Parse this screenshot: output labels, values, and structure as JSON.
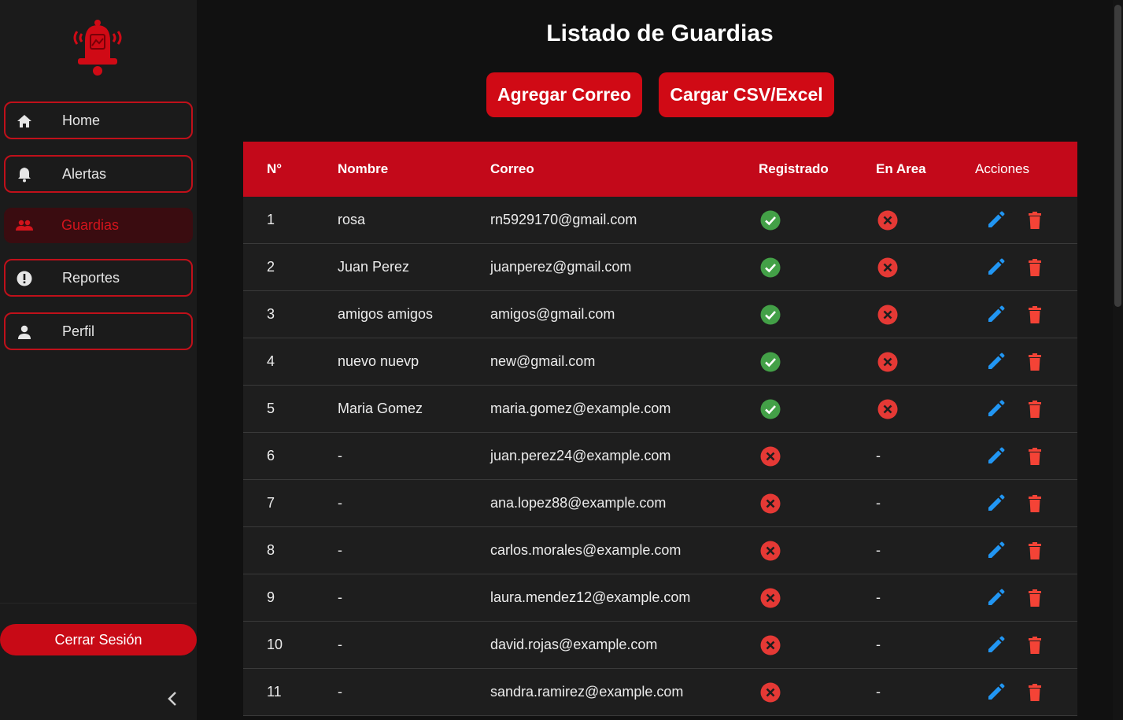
{
  "sidebar": {
    "items": [
      {
        "label": "Home",
        "icon": "home-icon"
      },
      {
        "label": "Alertas",
        "icon": "bell-icon"
      },
      {
        "label": "Guardias",
        "icon": "users-icon",
        "active": true
      },
      {
        "label": "Reportes",
        "icon": "alert-circle-icon"
      },
      {
        "label": "Perfil",
        "icon": "person-icon"
      }
    ],
    "logout_label": "Cerrar Sesión",
    "collapse_icon": "chevron-left-icon",
    "logo_icon": "alarm-bell-logo"
  },
  "page": {
    "title": "Listado de Guardias",
    "add_button": "Agregar Correo",
    "csv_button": "Cargar CSV/Excel"
  },
  "table": {
    "headers": {
      "num": "N°",
      "name": "Nombre",
      "email": "Correo",
      "registered": "Registrado",
      "in_area": "En Area",
      "actions": "Acciones"
    },
    "rows": [
      {
        "num": "1",
        "name": "rosa",
        "email": "rn5929170@gmail.com",
        "registered": true,
        "in_area": "no"
      },
      {
        "num": "2",
        "name": "Juan Perez",
        "email": "juanperez@gmail.com",
        "registered": true,
        "in_area": "no"
      },
      {
        "num": "3",
        "name": "amigos amigos",
        "email": "amigos@gmail.com",
        "registered": true,
        "in_area": "no"
      },
      {
        "num": "4",
        "name": "nuevo nuevp",
        "email": "new@gmail.com",
        "registered": true,
        "in_area": "no"
      },
      {
        "num": "5",
        "name": "Maria Gomez",
        "email": "maria.gomez@example.com",
        "registered": true,
        "in_area": "no"
      },
      {
        "num": "6",
        "name": "-",
        "email": "juan.perez24@example.com",
        "registered": false,
        "in_area": "-"
      },
      {
        "num": "7",
        "name": "-",
        "email": "ana.lopez88@example.com",
        "registered": false,
        "in_area": "-"
      },
      {
        "num": "8",
        "name": "-",
        "email": "carlos.morales@example.com",
        "registered": false,
        "in_area": "-"
      },
      {
        "num": "9",
        "name": "-",
        "email": "laura.mendez12@example.com",
        "registered": false,
        "in_area": "-"
      },
      {
        "num": "10",
        "name": "-",
        "email": "david.rojas@example.com",
        "registered": false,
        "in_area": "-"
      },
      {
        "num": "11",
        "name": "-",
        "email": "sandra.ramirez@example.com",
        "registered": false,
        "in_area": "-"
      }
    ]
  },
  "colors": {
    "accent": "#d00a15",
    "check": "#43a047",
    "cross": "#e53935",
    "edit": "#2196f3",
    "delete": "#f44336"
  }
}
